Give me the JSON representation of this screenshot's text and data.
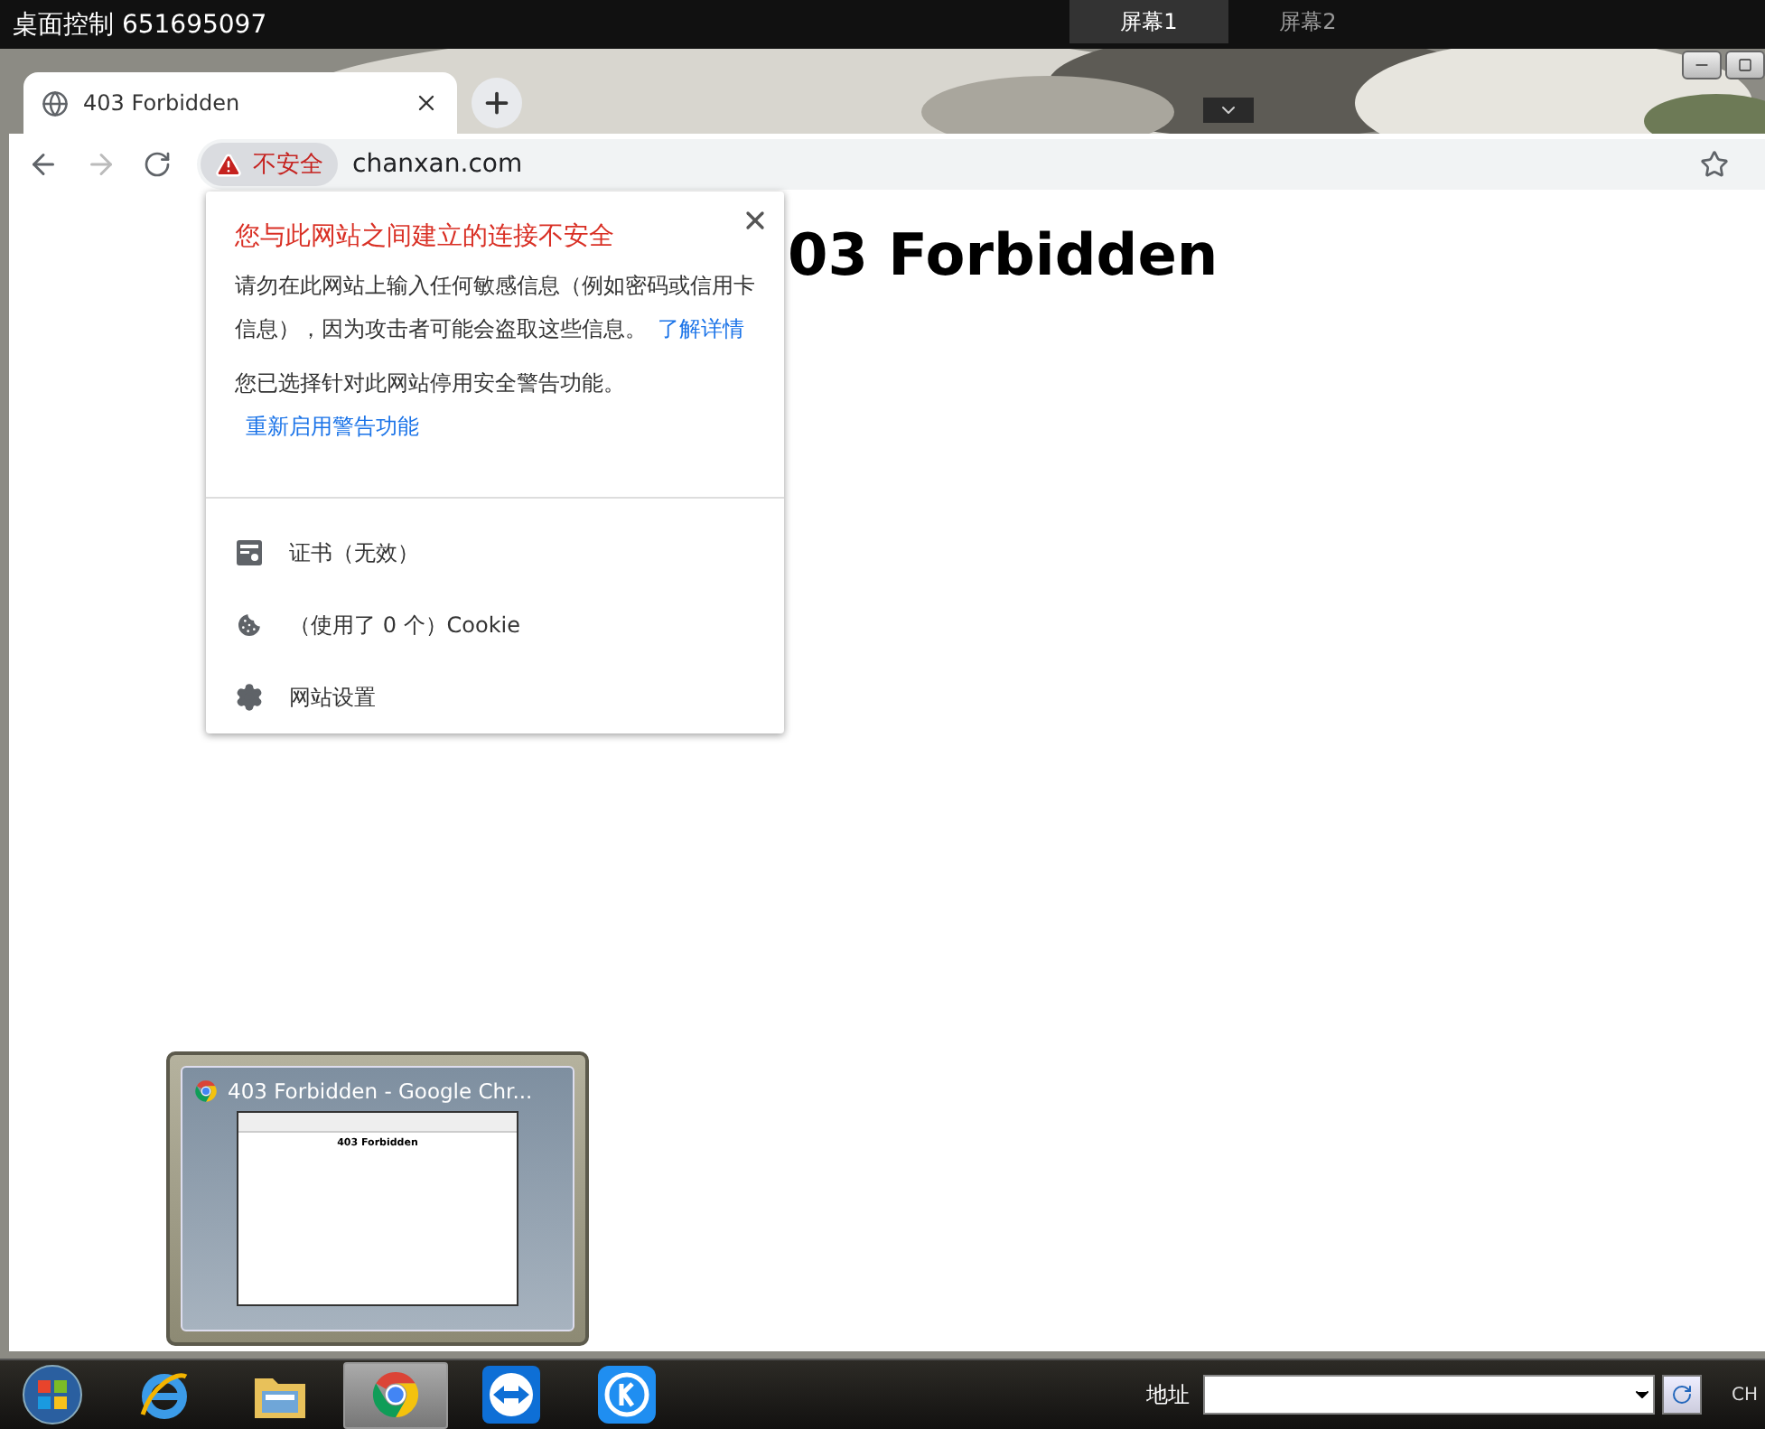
{
  "remote": {
    "title": "桌面控制 651695097",
    "screens": [
      {
        "label": "屏幕1",
        "selected": true
      },
      {
        "label": "屏幕2",
        "selected": false
      }
    ]
  },
  "browser": {
    "tabs": [
      {
        "title": "403 Forbidden",
        "selected": true
      }
    ],
    "security_chip": "不安全",
    "url": "chanxan.com",
    "forward_disabled": true,
    "page_heading": "03 Forbidden"
  },
  "site_info": {
    "title": "您与此网站之间建立的连接不安全",
    "paragraphs": [
      {
        "text": "请勿在此网站上输入任何敏感信息（例如密码或信用卡信息），因为攻击者可能会盗取这些信息。",
        "link": "了解详情"
      },
      {
        "text": "您已选择针对此网站停用安全警告功能。",
        "link": "重新启用警告功能"
      }
    ],
    "items": [
      {
        "kind": "certificate",
        "label": "证书（无效）"
      },
      {
        "kind": "cookie",
        "label": "（使用了 0 个）Cookie"
      },
      {
        "kind": "settings",
        "label": "网站设置"
      }
    ]
  },
  "thumbnail": {
    "title": "403 Forbidden - Google Chr...",
    "page_heading": "403 Forbidden"
  },
  "taskbar": {
    "apps": [
      {
        "kind": "ie",
        "selected": false
      },
      {
        "kind": "folder",
        "selected": false
      },
      {
        "kind": "chrome",
        "selected": true
      },
      {
        "kind": "teamviewer",
        "selected": false
      },
      {
        "kind": "kapp",
        "selected": false
      }
    ],
    "address_label": "地址",
    "lang": "CH"
  }
}
